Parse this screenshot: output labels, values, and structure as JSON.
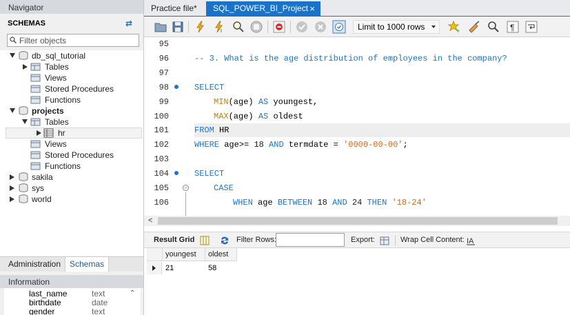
{
  "navigator": {
    "title": "Navigator",
    "schemas_label": "SCHEMAS",
    "filter_placeholder": "Filter objects",
    "tree": {
      "db_sql_tutorial": {
        "name": "db_sql_tutorial",
        "tables": "Tables",
        "views": "Views",
        "procedures": "Stored Procedures",
        "functions": "Functions"
      },
      "projects": {
        "name": "projects",
        "tables": "Tables",
        "table_hr": "hr",
        "views": "Views",
        "procedures": "Stored Procedures",
        "functions": "Functions"
      },
      "others": [
        "sakila",
        "sys",
        "world"
      ]
    },
    "tabs": {
      "administration": "Administration",
      "schemas": "Schemas"
    },
    "information": {
      "title": "Information",
      "columns": [
        {
          "name": "last_name",
          "type": "text"
        },
        {
          "name": "birthdate",
          "type": "date"
        },
        {
          "name": "gender",
          "type": "text"
        }
      ]
    }
  },
  "tabs": {
    "practice": "Practice file*",
    "active": "SQL_POWER_BI_Project"
  },
  "toolbar": {
    "limit_label": "Limit to 1000 rows"
  },
  "editor": {
    "lines": [
      {
        "n": "95"
      },
      {
        "n": "96",
        "comment": "-- 3. What is the age distribution of employees in the company?"
      },
      {
        "n": "97"
      },
      {
        "n": "98",
        "kw": "SELECT"
      },
      {
        "n": "99",
        "fn": "MIN",
        "arg": "(age)",
        "as": "AS",
        "alias": "youngest,"
      },
      {
        "n": "100",
        "fn": "MAX",
        "arg": "(age)",
        "as": "AS",
        "alias": "oldest"
      },
      {
        "n": "101",
        "kw": "FROM",
        "rest": "HR"
      },
      {
        "n": "102",
        "kw": "WHERE",
        "p1": "age>=",
        "num": "18",
        "and": "AND",
        "p2": "termdate =",
        "str": "'0000-00-00'",
        "end": ";"
      },
      {
        "n": "103"
      },
      {
        "n": "104",
        "kw": "SELECT"
      },
      {
        "n": "105",
        "kw": "CASE"
      },
      {
        "n": "106",
        "when": "WHEN",
        "col": "age",
        "between": "BETWEEN",
        "a": "18",
        "and": "AND",
        "b": "24",
        "then": "THEN",
        "str": "'18-24'"
      }
    ]
  },
  "result_bar": {
    "result_grid": "Result Grid",
    "filter_rows": "Filter Rows:",
    "export": "Export:",
    "wrap": "Wrap Cell Content:"
  },
  "grid": {
    "headers": [
      "youngest",
      "oldest"
    ],
    "rows": [
      [
        "21",
        "58"
      ]
    ]
  }
}
